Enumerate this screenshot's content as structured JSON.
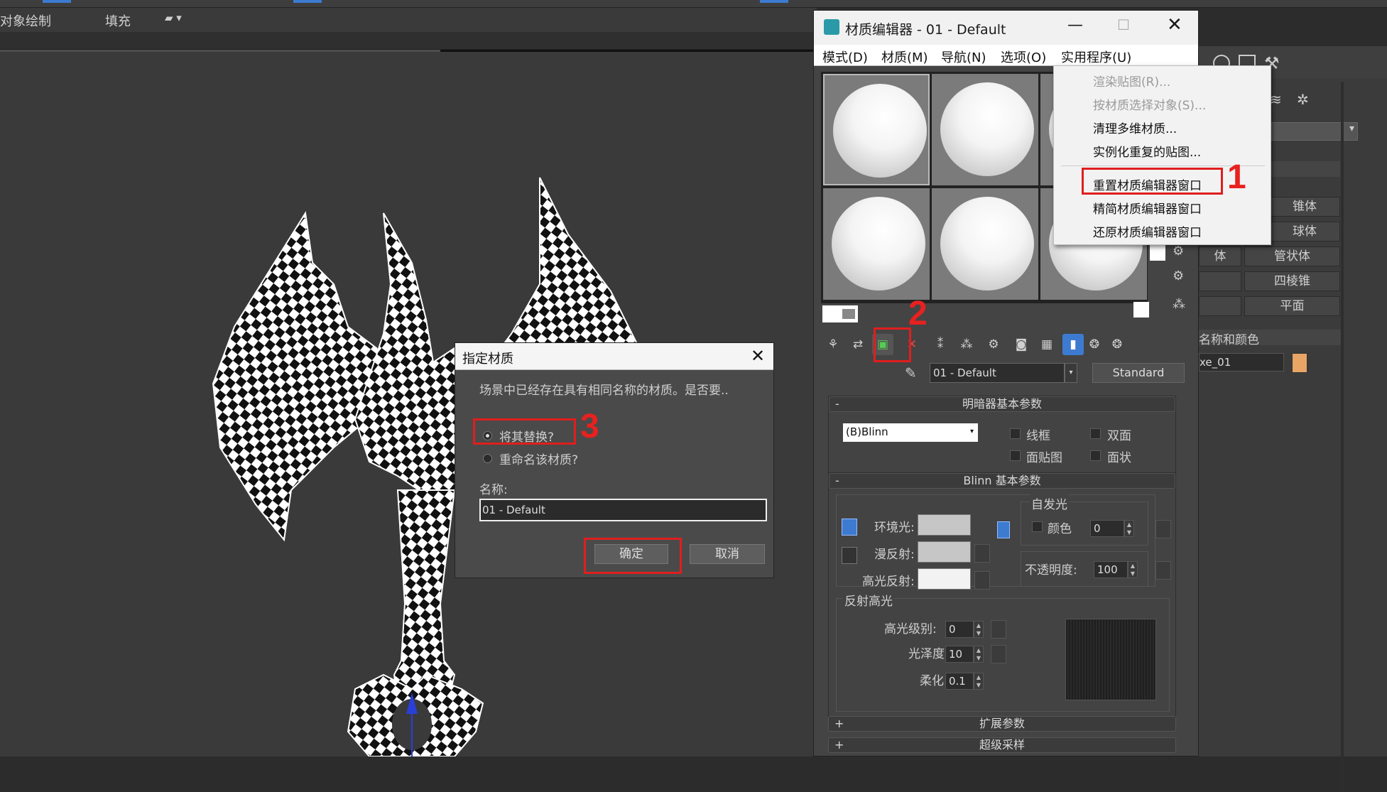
{
  "topbar": {
    "object_paint": "对象绘制",
    "fill": "填充"
  },
  "material_editor": {
    "title": "材质编辑器 - 01 - Default",
    "menus": [
      "模式(D)",
      "材质(M)",
      "导航(N)",
      "选项(O)",
      "实用程序(U)"
    ],
    "material_name": "01 - Default",
    "material_type": "Standard",
    "shader_rollout": {
      "title": "明暗器基本参数",
      "shader": "(B)Blinn",
      "wire": "线框",
      "two_sided": "双面",
      "face_map": "面贴图",
      "faceted": "面状"
    },
    "blinn_rollout": {
      "title": "Blinn 基本参数",
      "self_illum_group": "自发光",
      "color_label": "颜色",
      "color_value": "0",
      "ambient": "环境光:",
      "diffuse": "漫反射:",
      "specular": "高光反射:",
      "opacity_label": "不透明度:",
      "opacity_value": "100",
      "spec_group": "反射高光",
      "spec_level_label": "高光级别:",
      "spec_level": "0",
      "gloss_label": "光泽度:",
      "gloss": "10",
      "soften_label": "柔化:",
      "soften": "0.1"
    },
    "extended_rollout": "扩展参数",
    "supersampling_rollout": "超级采样",
    "collapse_minus": "-",
    "expand_plus": "+"
  },
  "utilities_menu": {
    "items": [
      "渲染贴图(R)...",
      "按材质选择对象(S)...",
      "清理多维材质...",
      "实例化重复的贴图...",
      "重置材质编辑器窗口",
      "精简材质编辑器窗口",
      "还原材质编辑器窗口"
    ]
  },
  "right_panel": {
    "buttons": [
      "锥体",
      "球体",
      "管状体",
      "四棱锥",
      "平面"
    ],
    "partial_labels": [
      "体",
      "",
      ""
    ],
    "name_color": "名称和颜色",
    "object_name": "xe_01"
  },
  "assign_dialog": {
    "title": "指定材质",
    "message": "场景中已经存在具有相同名称的材质。是否要..",
    "replace": "将其替换?",
    "rename": "重命名该材质?",
    "name_label": "名称:",
    "name_value": "01 - Default",
    "ok": "确定",
    "cancel": "取消"
  },
  "annotations": [
    "1",
    "2",
    "3"
  ],
  "colors": {
    "annotation_red": "#e01e1e",
    "object_color": "#e8a565",
    "accent_blue": "#3d7bd0"
  }
}
